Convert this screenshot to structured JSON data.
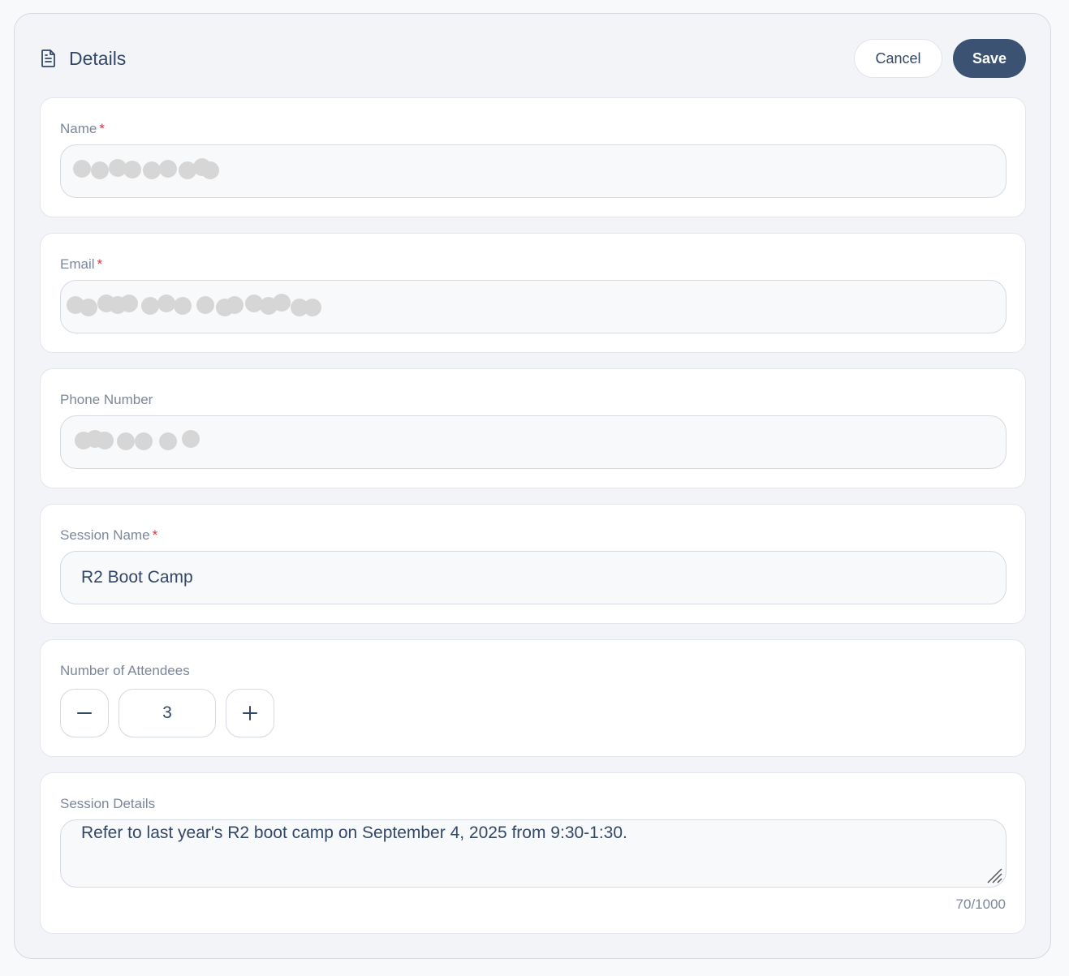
{
  "header": {
    "title": "Details",
    "icon": "document-icon",
    "cancel_label": "Cancel",
    "save_label": "Save"
  },
  "fields": {
    "name": {
      "label": "Name",
      "required_mark": "*",
      "value": ""
    },
    "email": {
      "label": "Email",
      "required_mark": "*",
      "value": ""
    },
    "phone": {
      "label": "Phone Number",
      "value": ""
    },
    "session_name": {
      "label": "Session Name",
      "required_mark": "*",
      "value": "R2 Boot Camp"
    },
    "attendees": {
      "label": "Number of Attendees",
      "value": "3",
      "decrement_icon": "minus-icon",
      "increment_icon": "plus-icon"
    },
    "session_details": {
      "label": "Session Details",
      "value": "Refer to last year's R2 boot camp on September 4, 2025 from 9:30-1:30.",
      "counter": "70/1000"
    }
  },
  "colors": {
    "primary": "#3b5272",
    "text": "#334766",
    "muted": "#7b879a",
    "required": "#e0303e",
    "panel_bg": "#f2f4f8",
    "redaction": "#d6d6d6"
  }
}
